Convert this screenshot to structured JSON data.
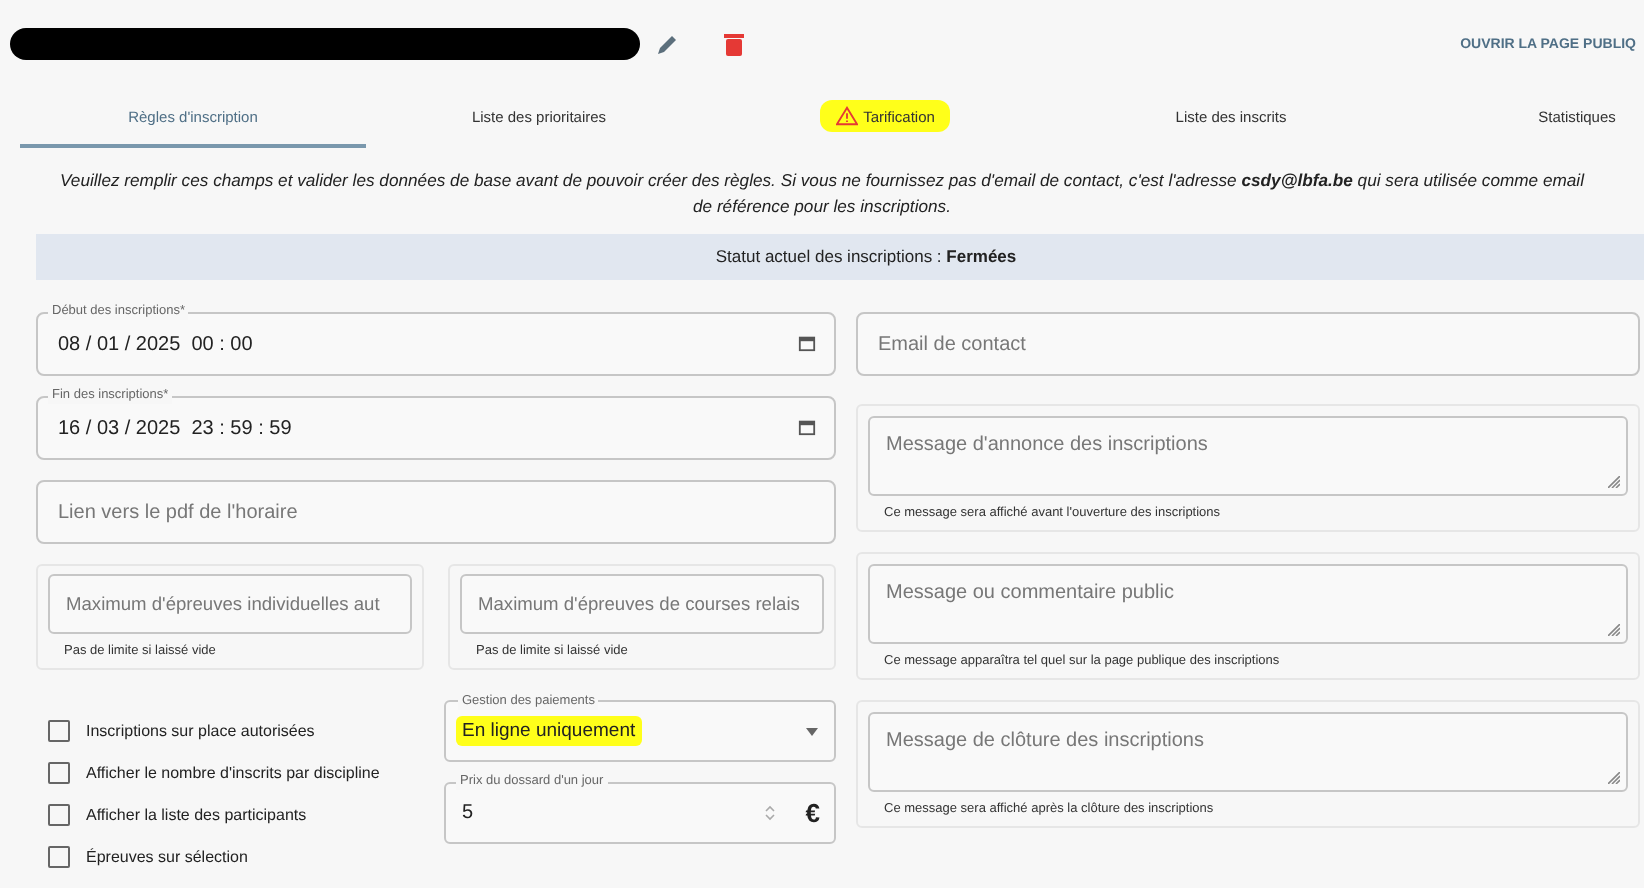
{
  "header": {
    "public_page_link": "OUVRIR LA PAGE PUBLIQ"
  },
  "tabs": [
    {
      "label": "Règles d'inscription",
      "selected": true,
      "warning": false,
      "highlighted": false
    },
    {
      "label": "Liste des prioritaires",
      "selected": false,
      "warning": false,
      "highlighted": false
    },
    {
      "label": "Tarification",
      "selected": false,
      "warning": true,
      "highlighted": true
    },
    {
      "label": "Liste des inscrits",
      "selected": false,
      "warning": false,
      "highlighted": false
    },
    {
      "label": "Statistiques",
      "selected": false,
      "warning": false,
      "highlighted": false
    }
  ],
  "notice": {
    "lines": [
      "Veuillez remplir ces champs et valider les données de base avant de pouvoir créer des règles. Si vous ne fournissez pas d'email de contact, c'est l'adresse **csdy@lbfa.be** qui sera utilisée comme email",
      "de référence pour les inscriptions."
    ]
  },
  "status": "Statut actuel des inscriptions : **Fermées**",
  "date_fields": [
    {
      "label": "Début des inscriptions*",
      "value": "08 / 01 / 2025  00 : 00"
    },
    {
      "label": "Fin des inscriptions*",
      "value": "16 / 03 / 2025  23 : 59 : 59"
    }
  ],
  "schedule_link": {
    "placeholder": "Lien vers le pdf de l'horaire"
  },
  "limits": [
    {
      "placeholder": "Maximum d'épreuves individuelles aut",
      "helper": "Pas de limite si laissé vide"
    },
    {
      "placeholder": "Maximum d'épreuves de courses relais",
      "helper": "Pas de limite si laissé vide"
    }
  ],
  "checkboxes": [
    {
      "label": "Inscriptions sur place autorisées",
      "checked": false
    },
    {
      "label": "Afficher le nombre d'inscrits par discipline",
      "checked": false
    },
    {
      "label": "Afficher la liste des participants",
      "checked": false
    },
    {
      "label": "Épreuves sur sélection",
      "checked": false
    }
  ],
  "payment": {
    "label": "Gestion des paiements",
    "value": "En ligne uniquement",
    "highlighted": true
  },
  "price": {
    "label": "Prix du dossard d'un jour",
    "value": "5",
    "unit": "€"
  },
  "contact_email": {
    "placeholder": "Email de contact"
  },
  "messages": [
    {
      "placeholder": "Message d'annonce des inscriptions",
      "helper": "Ce message sera affiché avant l'ouverture des inscriptions"
    },
    {
      "placeholder": "Message ou commentaire public",
      "helper": "Ce message apparaîtra tel quel sur la page publique des inscriptions"
    },
    {
      "placeholder": "Message de clôture des inscriptions",
      "helper": "Ce message sera affiché après la clôture des inscriptions"
    }
  ]
}
